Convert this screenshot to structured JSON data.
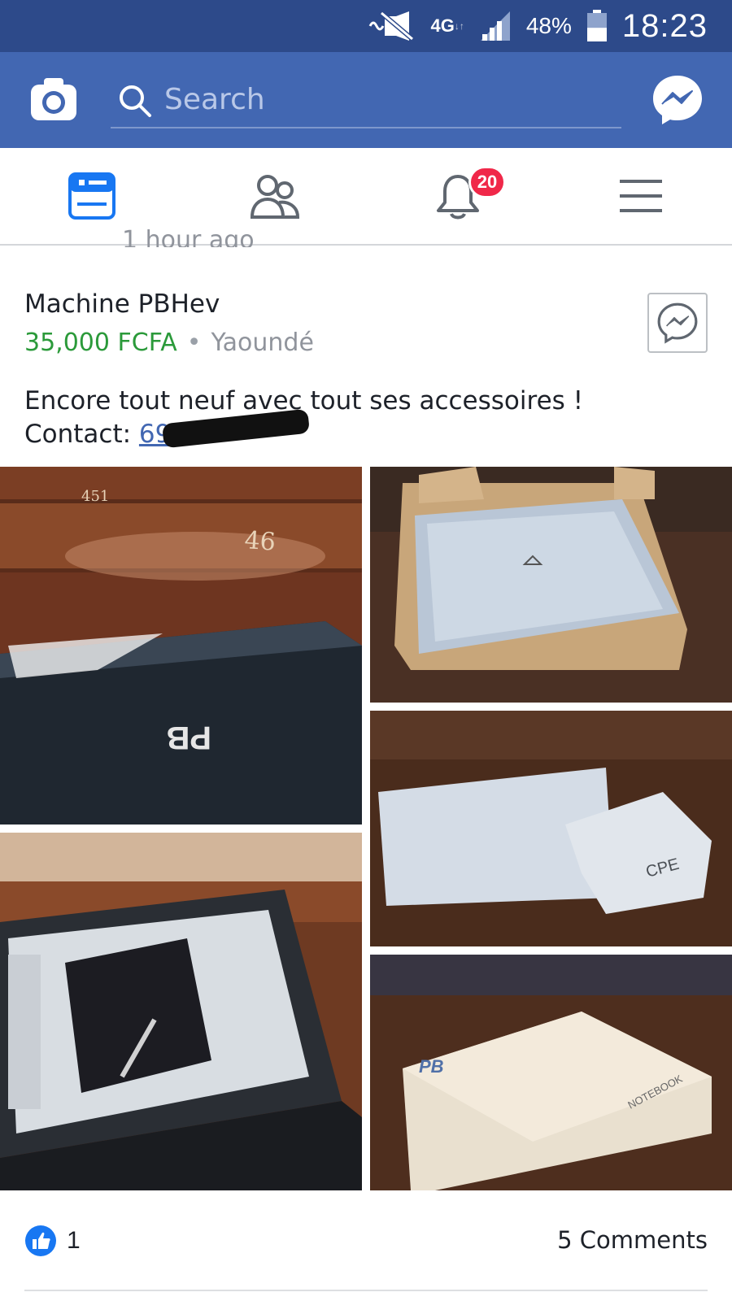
{
  "status_bar": {
    "network": "4G",
    "battery_percent": "48%",
    "battery_level": 0.48,
    "time": "18:23"
  },
  "header": {
    "search_placeholder": "Search"
  },
  "nav": {
    "notifications_badge": "20",
    "active_tab": "news-feed"
  },
  "post": {
    "previous_timestamp_partial": "1 hour ago",
    "title": "Machine PBHev",
    "price": "35,000 FCFA",
    "separator": "•",
    "location": "Yaoundé",
    "description": "Encore tout neuf avec tout ses accessoires !",
    "contact_label": "Contact:",
    "contact_phone_visible": "69",
    "photos": [
      {
        "label_text": "PB"
      },
      {
        "label_text": ""
      },
      {
        "label_text": "CPE"
      },
      {
        "label_text": ""
      },
      {
        "label_text": "PB",
        "box_text": "NOTEBOOK"
      }
    ]
  },
  "reactions": {
    "like_count": "1",
    "comments": "5 Comments"
  },
  "colors": {
    "status_bar": "#2d4a8a",
    "header": "#4267b2",
    "price_green": "#2b9a3a",
    "badge_red": "#f02849",
    "active_icon_blue": "#1877f2"
  },
  "icons": [
    "camera-icon",
    "search-icon",
    "messenger-icon",
    "news-feed-icon",
    "friends-icon",
    "bell-icon",
    "menu-icon",
    "like-icon"
  ]
}
